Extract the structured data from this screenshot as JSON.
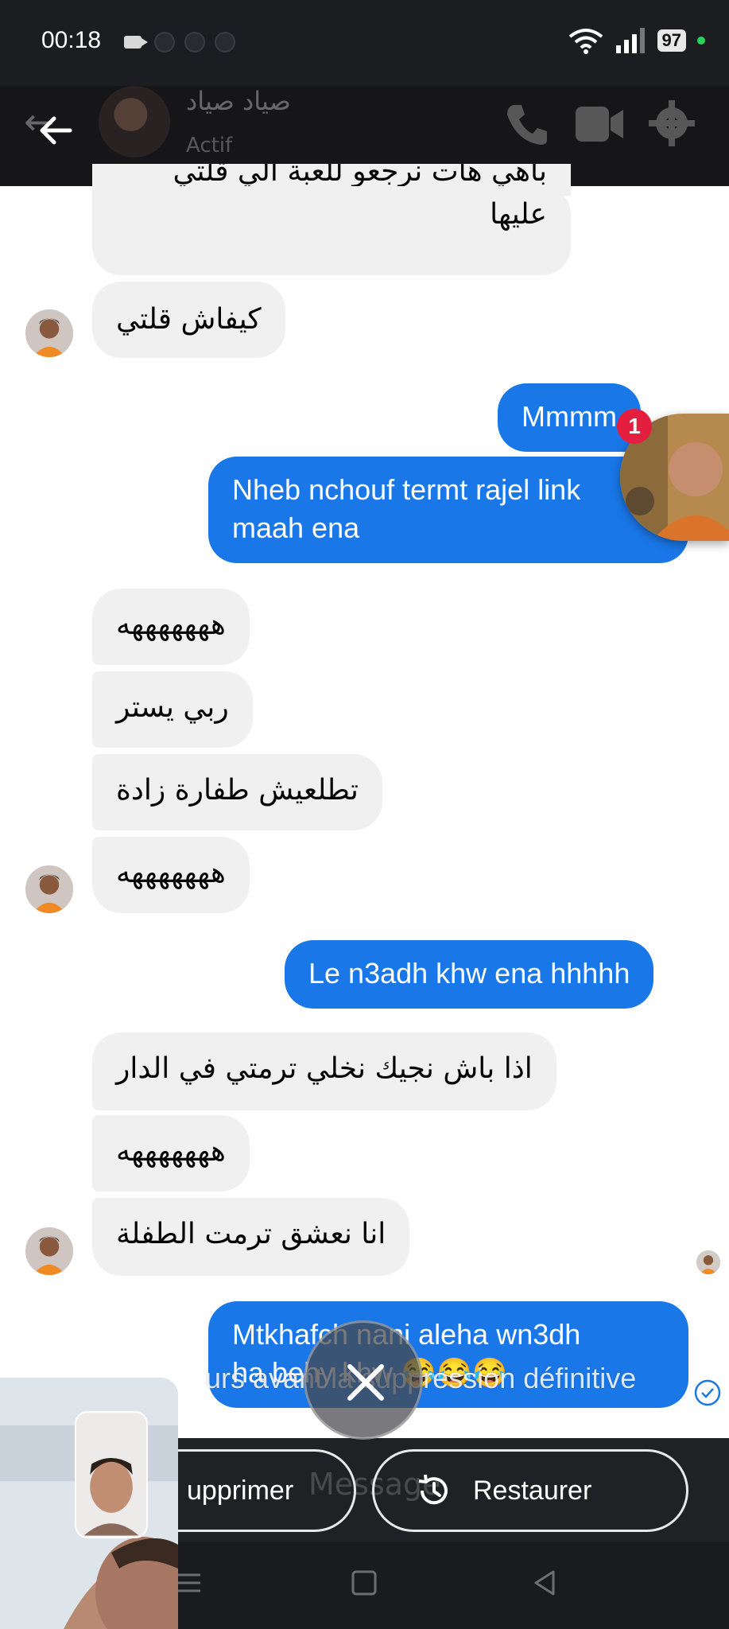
{
  "status_bar": {
    "time": "00:18",
    "battery": "97"
  },
  "header": {
    "contact_name": "صياد صياد",
    "presence": "Actif"
  },
  "messages": [
    {
      "side": "in",
      "text": "باهي هات نرجعو للعبة الي قلتي"
    },
    {
      "side": "in",
      "text": "عليها"
    },
    {
      "side": "in",
      "text": "كيفاش قلتي"
    },
    {
      "side": "out",
      "text": "Mmmm"
    },
    {
      "side": "out",
      "text": "Nheb nchouf termt rajel link"
    },
    {
      "side": "out",
      "text": "maah ena"
    },
    {
      "side": "in",
      "text": "هههههههه"
    },
    {
      "side": "in",
      "text": "ربي يستر"
    },
    {
      "side": "in",
      "text": "تطلعيش طفارة زادة"
    },
    {
      "side": "in",
      "text": "هههههههه"
    },
    {
      "side": "out",
      "text": "Le n3adh khw ena hhhhh"
    },
    {
      "side": "in",
      "text": "اذا باش نجيك نخلي ترمتي في الدار"
    },
    {
      "side": "in",
      "text": "هههههههه"
    },
    {
      "side": "in",
      "text": "انا نعشق ترمت الطفلة"
    },
    {
      "side": "out",
      "text": "Mtkhafch nani aleha wn3dh"
    },
    {
      "side": "out",
      "text": "ha behy khw 😂😂😂"
    }
  ],
  "chat_head": {
    "badge": "1"
  },
  "overlay": {
    "text": "urs avant la suppression définitive"
  },
  "actions": {
    "delete": "upprimer",
    "restore": "Restaurer",
    "composer_placeholder": "Message"
  },
  "colors": {
    "outgoing": "#1a77e8",
    "incoming": "#f0f0f1",
    "badge": "#e41e3f"
  }
}
